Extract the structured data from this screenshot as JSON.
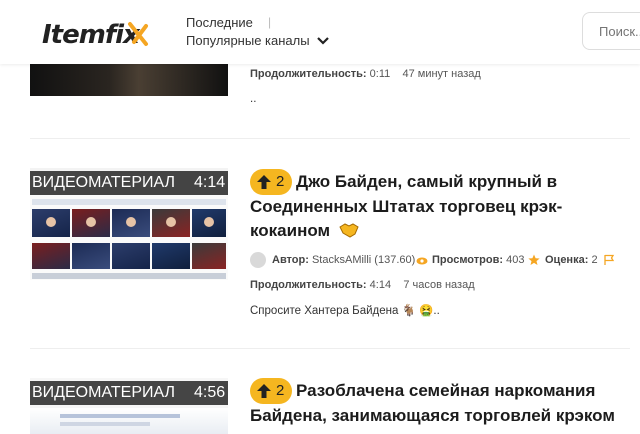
{
  "header": {
    "logo": "Itemfix",
    "nav_recent": "Последние",
    "nav_separator": "|",
    "nav_popular": "Популярные каналы",
    "search_placeholder": "Поиск..."
  },
  "labels": {
    "duration": "Продолжительность:",
    "author": "Автор:",
    "views": "Просмотров:",
    "rating": "Оценка:"
  },
  "items": [
    {
      "duration_value": "0:11",
      "ago": "47 минут назад",
      "description": ".."
    },
    {
      "thumb_label": "ВИДЕОМАТЕРИАЛ",
      "thumb_duration": "4:14",
      "votes": "2",
      "title_line1": "Джо Байден, самый крупный в",
      "title_line2": "Соединенных Штатах торговец крэк-",
      "title_line3": "кокаином",
      "author_value": "StacksAMilli (137.60)",
      "views_value": "403",
      "rating_value": "2",
      "duration_value": "4:14",
      "ago": "7 часов назад",
      "description": "Спросите Хантера Байдена 🐐 🤮.."
    },
    {
      "thumb_label": "ВИДЕОМАТЕРИАЛ",
      "thumb_duration": "4:56",
      "votes": "2",
      "title_line1": "Разоблачена семейная наркомания",
      "title_line2": "Байдена, занимающаяся торговлей крэком"
    }
  ],
  "colors": {
    "badge": "#f5b620",
    "accent_orange": "#f5a623",
    "logo_dark": "#222222"
  }
}
